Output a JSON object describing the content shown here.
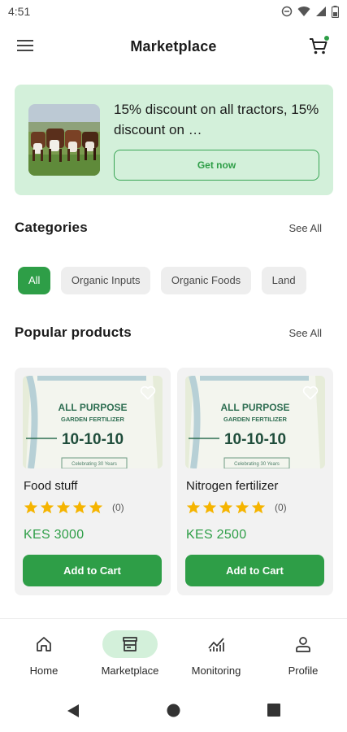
{
  "status_bar": {
    "time": "4:51"
  },
  "app_bar": {
    "title": "Marketplace"
  },
  "promo": {
    "text": "15% discount on all tractors, 15% discount on …",
    "button_label": "Get now"
  },
  "categories": {
    "title": "Categories",
    "see_all": "See All",
    "chips": [
      {
        "label": "All",
        "active": true
      },
      {
        "label": "Organic Inputs",
        "active": false
      },
      {
        "label": "Organic Foods",
        "active": false
      },
      {
        "label": "Land",
        "active": false
      }
    ]
  },
  "popular": {
    "title": "Popular products",
    "see_all": "See All",
    "products": [
      {
        "name": "Food stuff",
        "rating": 5,
        "rating_count": "(0)",
        "price": "KES 3000",
        "button_label": "Add to Cart",
        "bag_text": {
          "line1": "ALL PURPOSE",
          "line2": "GARDEN FERTILIZER",
          "grade": "10-10-10",
          "sub": "Celebrating 30 Years"
        }
      },
      {
        "name": "Nitrogen fertilizer",
        "rating": 5,
        "rating_count": "(0)",
        "price": "KES 2500",
        "button_label": "Add to Cart",
        "bag_text": {
          "line1": "ALL PURPOSE",
          "line2": "GARDEN FERTILIZER",
          "grade": "10-10-10",
          "sub": "Celebrating 30 Years"
        }
      }
    ]
  },
  "bottom_nav": {
    "items": [
      {
        "label": "Home",
        "icon": "home-icon",
        "active": false
      },
      {
        "label": "Marketplace",
        "icon": "store-icon",
        "active": true
      },
      {
        "label": "Monitoring",
        "icon": "chart-icon",
        "active": false
      },
      {
        "label": "Profile",
        "icon": "person-icon",
        "active": false
      }
    ]
  },
  "colors": {
    "accent": "#2e9e47",
    "accent_light": "#d3f0da",
    "star": "#f5b400",
    "chip_bg": "#eeeeee",
    "card_bg": "#f2f2f2"
  }
}
